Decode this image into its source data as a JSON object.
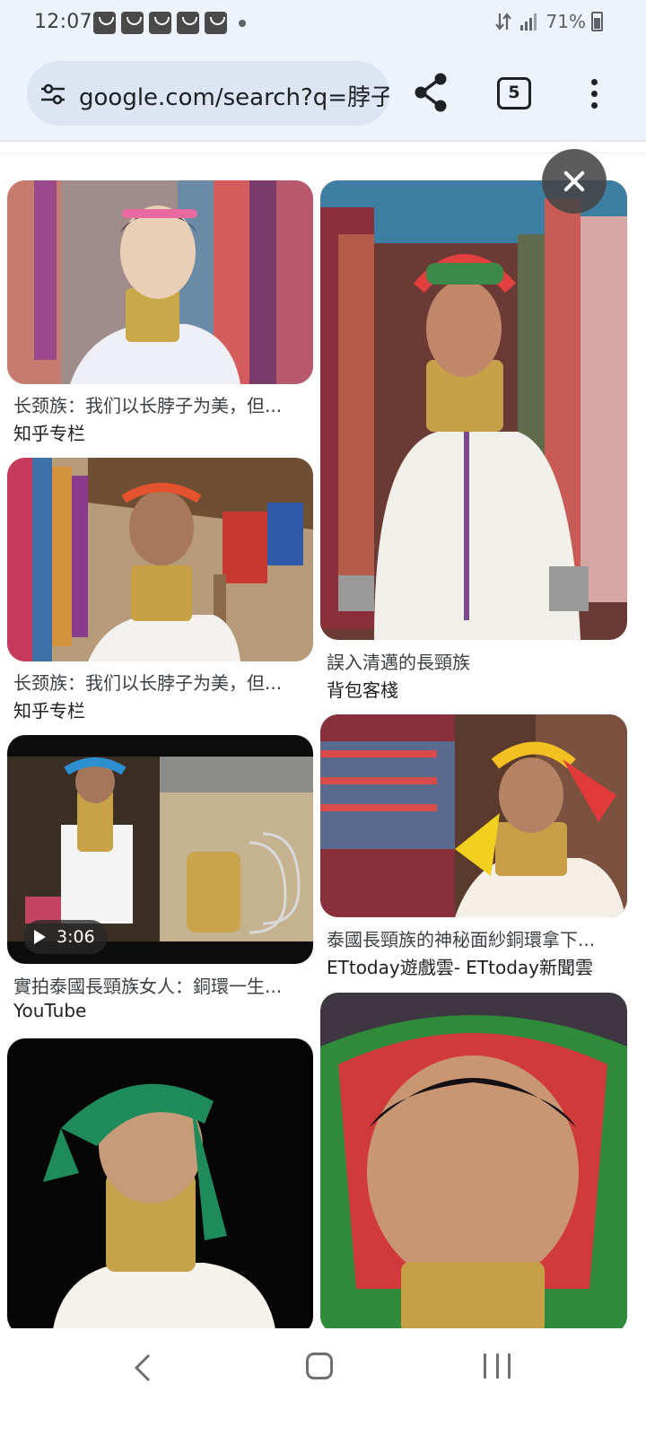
{
  "status_bar": {
    "time": "12:07",
    "notification_icons": [
      "smile-icon",
      "smile-icon",
      "smile-icon",
      "smile-icon",
      "smile-icon"
    ],
    "battery": "71%"
  },
  "toolbar": {
    "url": "google.com/search?q=脖子:",
    "tab_count": "5"
  },
  "results": [
    {
      "title": "长颈族：我们以长脖子为美，但...",
      "source": "知乎专栏"
    },
    {
      "title": "誤入清邁的長頸族",
      "source": "背包客棧"
    },
    {
      "title": "长颈族：我们以长脖子为美，但...",
      "source": "知乎专栏"
    },
    {
      "title": "泰國長頸族的神秘面紗銅環拿下...",
      "source": "ETtoday遊戲雲- ETtoday新聞雲"
    },
    {
      "title": "實拍泰國長頸族女人：銅環一生...",
      "source": "YouTube",
      "duration": "3:06"
    },
    {
      "title": "",
      "source": ""
    },
    {
      "title": "",
      "source": ""
    }
  ],
  "colors": {
    "chrome_bg": "#eef3fb",
    "url_bar_bg": "#dde5f2",
    "text_primary": "#202124",
    "text_secondary": "#3c4043"
  }
}
